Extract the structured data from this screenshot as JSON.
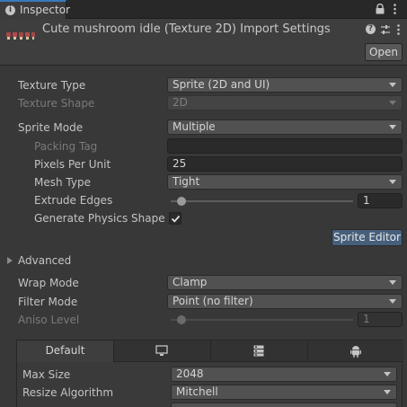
{
  "window": {
    "tab_label": "Inspector",
    "tab_icon": "info-icon",
    "lock_icon": "lock-icon",
    "menu_icon": "kebab-menu-icon"
  },
  "header": {
    "title": "Cute mushroom idle (Texture 2D) Import Settings",
    "open_label": "Open",
    "help_icon": "help-icon",
    "preset_icon": "preset-icon",
    "menu_icon": "kebab-menu-icon"
  },
  "properties": {
    "texture_type": {
      "label": "Texture Type",
      "value": "Sprite (2D and UI)"
    },
    "texture_shape": {
      "label": "Texture Shape",
      "value": "2D"
    },
    "sprite_mode": {
      "label": "Sprite Mode",
      "value": "Multiple"
    },
    "packing_tag": {
      "label": "Packing Tag",
      "value": ""
    },
    "pixels_per_unit": {
      "label": "Pixels Per Unit",
      "value": "25"
    },
    "mesh_type": {
      "label": "Mesh Type",
      "value": "Tight"
    },
    "extrude_edges": {
      "label": "Extrude Edges",
      "value": "1",
      "slider_fraction": 0.06
    },
    "generate_physics_shape": {
      "label": "Generate Physics Shape",
      "checked": true
    },
    "sprite_editor_label": "Sprite Editor",
    "advanced_label": "Advanced",
    "wrap_mode": {
      "label": "Wrap Mode",
      "value": "Clamp"
    },
    "filter_mode": {
      "label": "Filter Mode",
      "value": "Point (no filter)"
    },
    "aniso_level": {
      "label": "Aniso Level",
      "value": "1",
      "slider_fraction": 0.06
    }
  },
  "platform": {
    "tabs": [
      {
        "label": "Default",
        "icon": ""
      },
      {
        "label": "",
        "icon": "monitor-icon"
      },
      {
        "label": "",
        "icon": "server-icon"
      },
      {
        "label": "",
        "icon": "android-icon"
      }
    ],
    "max_size": {
      "label": "Max Size",
      "value": "2048"
    },
    "resize_algorithm": {
      "label": "Resize Algorithm",
      "value": "Mitchell"
    }
  },
  "colors": {
    "background": "#383838",
    "accent": "#3a79bb",
    "sprite_editor_button": "#46607c"
  }
}
